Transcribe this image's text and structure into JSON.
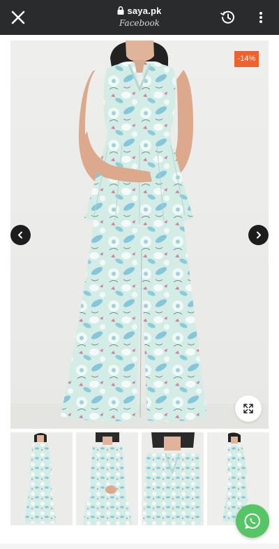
{
  "browser": {
    "domain": "saya.pk",
    "source": "Facebook",
    "icons": [
      "close-icon",
      "lock-icon",
      "history-icon",
      "more-vert-icon"
    ]
  },
  "product": {
    "discount_badge": "-14%",
    "colors": {
      "badge": "#f2602b",
      "fabric_base": "#cfe9e4",
      "fabric_blue": "#7fc3d9",
      "fabric_pink": "#d27f9a",
      "whatsapp": "#56c566"
    }
  },
  "gallery": {
    "thumbnail_count": 4,
    "icons": [
      "chevron-left-icon",
      "chevron-right-icon",
      "expand-icon",
      "whatsapp-icon"
    ]
  }
}
